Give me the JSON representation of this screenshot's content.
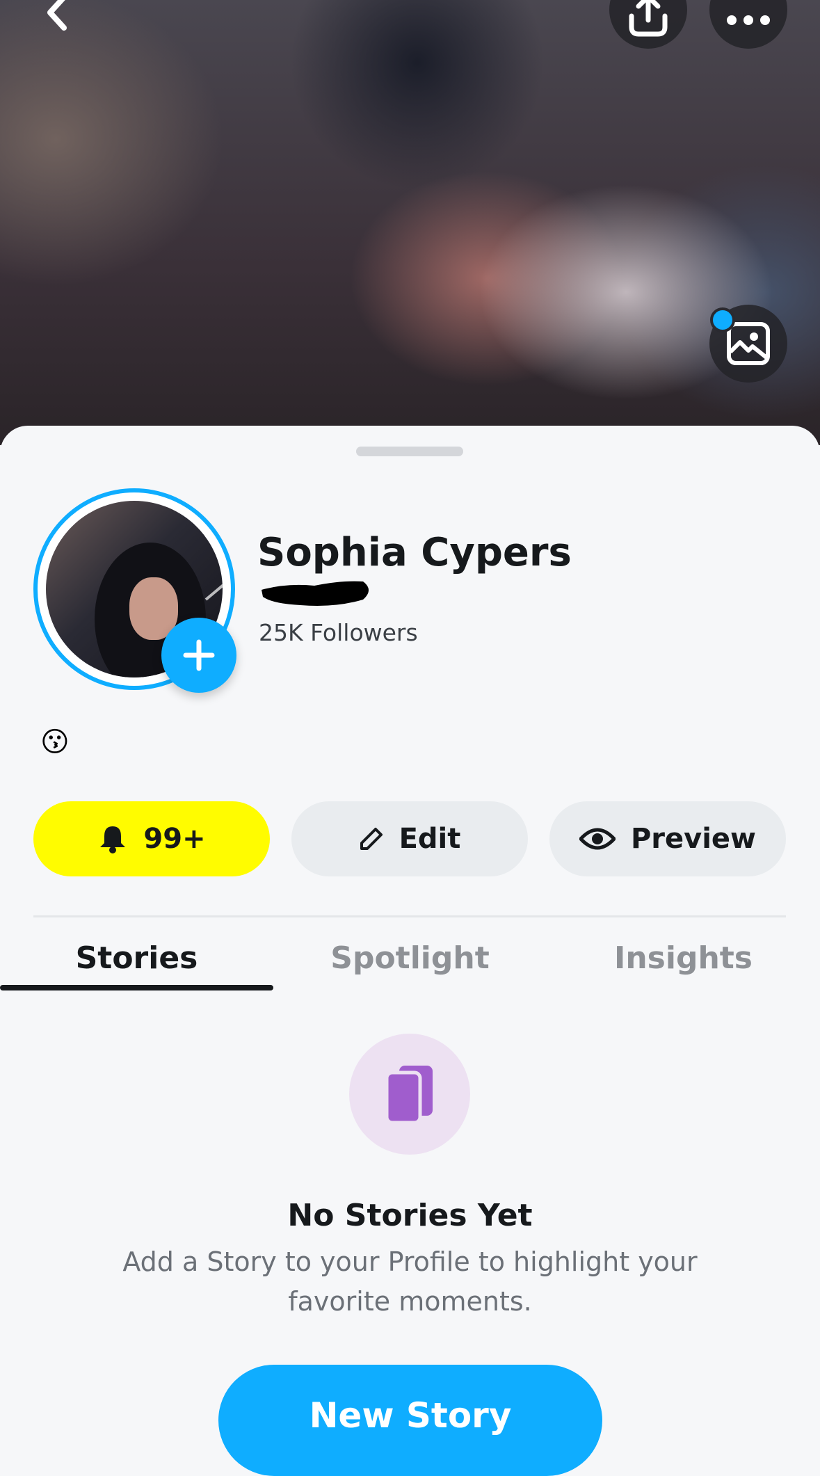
{
  "profile": {
    "name": "Sophia Cypers",
    "followers": "25K Followers",
    "bio_emoji": "😗"
  },
  "actions": {
    "notifications_label": "99+",
    "edit_label": "Edit",
    "preview_label": "Preview"
  },
  "tabs": [
    {
      "label": "Stories",
      "active": true
    },
    {
      "label": "Spotlight",
      "active": false
    },
    {
      "label": "Insights",
      "active": false
    }
  ],
  "empty_state": {
    "title": "No Stories Yet",
    "description": "Add a Story to your Profile to highlight your favorite moments.",
    "button_label": "New Story",
    "icon": "stories-stack-icon"
  },
  "header": {
    "icons": [
      "back-icon",
      "share-icon",
      "more-icon",
      "gallery-icon"
    ]
  },
  "colors": {
    "accent_blue": "#0FADFF",
    "notification_yellow": "#FFFC00",
    "story_purple": "#A05DCD"
  }
}
